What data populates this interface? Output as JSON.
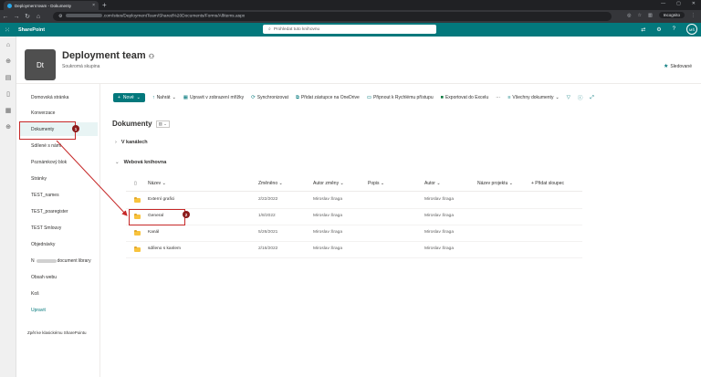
{
  "browser": {
    "tab_title": "Deployment team - Dokumenty",
    "tab_close": "×",
    "new_tab": "+",
    "url_prefix": "",
    "url_rest": ".com/sites/DeploymentTeam/Shared%20Documents/Forms/AllItems.aspx",
    "incognito_label": "Incognito"
  },
  "suitebar": {
    "app_name": "SharePoint",
    "search_placeholder": "Prohledat tuto knihovnu",
    "avatar_initials": "MŠ"
  },
  "site": {
    "logo_initials": "Dt",
    "title": "Deployment team",
    "subtitle": "Soukromá skupina",
    "follow_label": "Sledované"
  },
  "leftnav": {
    "items": [
      {
        "label": "Domovská stránka"
      },
      {
        "label": "Konverzace"
      },
      {
        "label": "Dokumenty"
      },
      {
        "label": "Sdílené s námi"
      },
      {
        "label": "Poznámkový blok"
      },
      {
        "label": "Stránky"
      },
      {
        "label": "TEST_names"
      },
      {
        "label": "TEST_poaregister"
      },
      {
        "label": "TEST Smlouvy"
      },
      {
        "label": "Objednávky"
      },
      {
        "label": "document library"
      },
      {
        "label": "Obsah webu"
      },
      {
        "label": "Koš"
      },
      {
        "label": "Upravit"
      }
    ],
    "footer": "Zpět ke klasickému SharePointu"
  },
  "commandbar": {
    "new": "Nové",
    "upload": "Nahrát",
    "grid_edit": "Upravit v zobrazení mřížky",
    "sync": "Synchronizovat",
    "onedrive_shortcut": "Přidat zástupce na OneDrive",
    "quick_access": "Připnout k Rychlému přístupu",
    "export_excel": "Exportovat do Excelu",
    "more": "···",
    "all_docs": "Všechny dokumenty"
  },
  "library": {
    "title": "Dokumenty",
    "section_channels": "V kanálech",
    "section_web": "Webová knihovna"
  },
  "table": {
    "headers": {
      "name": "Název",
      "modified": "Změněno",
      "modified_by": "Autor změny",
      "description": "Popis",
      "author": "Autor",
      "project_name": "Název projektu",
      "add_column": "+ Přidat sloupec"
    },
    "rows": [
      {
        "name": "Externí grafici",
        "modified": "2/22/2022",
        "modified_by": "Miroslav Šraga",
        "author": "Miroslav Šraga"
      },
      {
        "name": "General",
        "modified": "1/8/2022",
        "modified_by": "Miroslav Šraga",
        "author": "Miroslav Šraga"
      },
      {
        "name": "Kanál",
        "modified": "5/26/2021",
        "modified_by": "Miroslav Šraga",
        "author": "Miroslav Šraga"
      },
      {
        "name": "sdíleno s kanlem",
        "modified": "2/16/2022",
        "modified_by": "Miroslav Šraga",
        "author": "Miroslav Šraga"
      }
    ]
  },
  "annotations": {
    "marker1": "1",
    "marker2": "2"
  },
  "colors": {
    "suitebar": "#03787c",
    "highlight": "#c62828",
    "marker": "#8b1a1a"
  }
}
